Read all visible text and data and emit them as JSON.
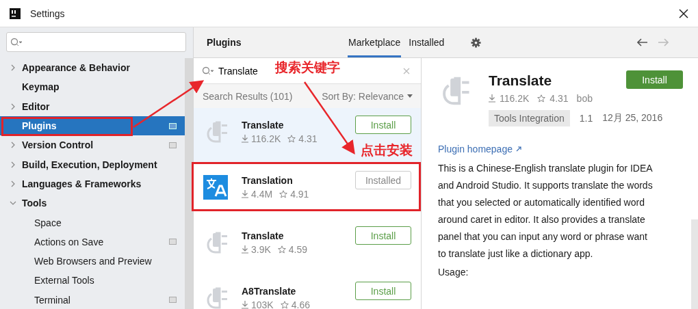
{
  "window": {
    "title": "Settings"
  },
  "sidebar": {
    "items": [
      {
        "label": "Appearance & Behavior",
        "expandable": true,
        "expanded": false,
        "selected": false,
        "project_icon": false
      },
      {
        "label": "Keymap",
        "expandable": false,
        "selected": false,
        "project_icon": false
      },
      {
        "label": "Editor",
        "expandable": true,
        "expanded": false,
        "selected": false,
        "project_icon": false
      },
      {
        "label": "Plugins",
        "expandable": false,
        "selected": true,
        "project_icon": true
      },
      {
        "label": "Version Control",
        "expandable": true,
        "expanded": false,
        "selected": false,
        "project_icon": true
      },
      {
        "label": "Build, Execution, Deployment",
        "expandable": true,
        "expanded": false,
        "selected": false,
        "project_icon": false
      },
      {
        "label": "Languages & Frameworks",
        "expandable": true,
        "expanded": false,
        "selected": false,
        "project_icon": false
      },
      {
        "label": "Tools",
        "expandable": true,
        "expanded": true,
        "selected": false,
        "project_icon": false,
        "children": [
          {
            "label": "Space",
            "selected": false,
            "project_icon": false
          },
          {
            "label": "Actions on Save",
            "selected": false,
            "project_icon": true
          },
          {
            "label": "Web Browsers and Preview",
            "selected": false,
            "project_icon": false
          },
          {
            "label": "External Tools",
            "selected": false,
            "project_icon": false
          },
          {
            "label": "Terminal",
            "selected": false,
            "project_icon": true
          }
        ]
      }
    ]
  },
  "header": {
    "title": "Plugins",
    "tabs": [
      {
        "label": "Marketplace",
        "selected": true
      },
      {
        "label": "Installed",
        "selected": false
      }
    ]
  },
  "search": {
    "value": "Translate"
  },
  "results": {
    "label": "Search Results (101)",
    "sort": "Sort By: Relevance"
  },
  "plugins": [
    {
      "kind": "plug",
      "name": "Translate",
      "downloads": "116.2K",
      "rating": "4.31",
      "button": "Install",
      "installed": false,
      "selected": true
    },
    {
      "kind": "translate",
      "name": "Translation",
      "downloads": "4.4M",
      "rating": "4.91",
      "button": "Installed",
      "installed": true,
      "selected": false
    },
    {
      "kind": "plug",
      "name": "Translate",
      "downloads": "3.9K",
      "rating": "4.59",
      "button": "Install",
      "installed": false,
      "selected": false
    },
    {
      "kind": "plug",
      "name": "A8Translate",
      "downloads": "103K",
      "rating": "4.66",
      "button": "Install",
      "installed": false,
      "selected": false
    }
  ],
  "details": {
    "name": "Translate",
    "button": "Install",
    "downloads": "116.2K",
    "rating": "4.31",
    "author": "bob",
    "tag": "Tools Integration",
    "version": "1.1",
    "date": "12月 25, 2016",
    "homepage": "Plugin homepage",
    "description": "This is a Chinese-English translate plugin for IDEA and Android Studio. It supports translate the words that you selected or automatically identified word around caret in editor. It also provides a translate panel that you can input any word or phrase want to translate just like a dictionary app.",
    "usage": "Usage:"
  },
  "annotations": [
    {
      "kind": "label",
      "text": "搜索关键字"
    },
    {
      "kind": "label",
      "text": "点击安装"
    }
  ]
}
